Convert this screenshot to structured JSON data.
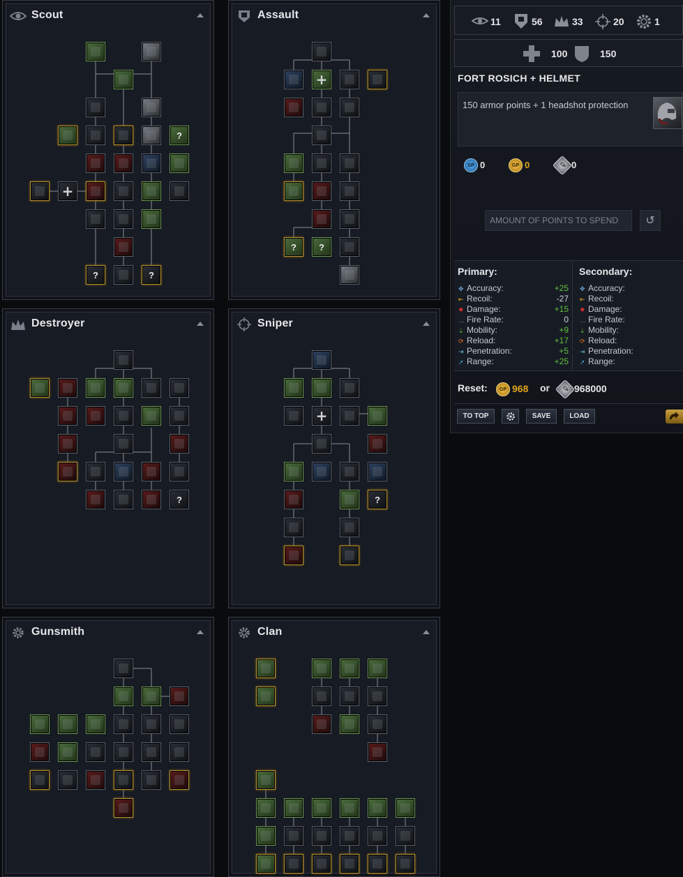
{
  "panels": {
    "scout": {
      "title": "Scout"
    },
    "assault": {
      "title": "Assault"
    },
    "destroyer": {
      "title": "Destroyer"
    },
    "sniper": {
      "title": "Sniper"
    },
    "gunsmith": {
      "title": "Gunsmith"
    },
    "clan": {
      "title": "Clan"
    }
  },
  "skill_labels": {
    "question": "?",
    "plus": "+"
  },
  "stats_bar": {
    "scout": "11",
    "assault": "56",
    "destroyer": "33",
    "sniper": "20",
    "gunsmith": "1"
  },
  "health_bar": {
    "health": "100",
    "armor": "150"
  },
  "item": {
    "title": "FORT ROSICH + HELMET",
    "description": "150 armor points + 1 headshot protection"
  },
  "currencies": [
    {
      "code": "SP",
      "value": "0",
      "color": "#3b8fd6"
    },
    {
      "code": "GP",
      "value": "0",
      "color": "#e0a21d"
    },
    {
      "code": "CP",
      "value": "0",
      "color": "#9aa0a8"
    }
  ],
  "points_input": {
    "placeholder": "AMOUNT OF POINTS TO SPEND"
  },
  "primary": {
    "heading": "Primary:",
    "rows": [
      {
        "label": "Accuracy:",
        "value": "+25",
        "icon": "accuracy-icon"
      },
      {
        "label": "Recoil:",
        "value": "-27",
        "icon": "recoil-icon"
      },
      {
        "label": "Damage:",
        "value": "+15",
        "icon": "damage-icon"
      },
      {
        "label": "Fire Rate:",
        "value": "0",
        "icon": "fire-rate-icon"
      },
      {
        "label": "Mobility:",
        "value": "+9",
        "icon": "mobility-icon"
      },
      {
        "label": "Reload:",
        "value": "+17",
        "icon": "reload-icon"
      },
      {
        "label": "Penetration:",
        "value": "+5",
        "icon": "penetration-icon"
      },
      {
        "label": "Range:",
        "value": "+25",
        "icon": "range-icon"
      }
    ]
  },
  "secondary": {
    "heading": "Secondary:",
    "rows": [
      {
        "label": "Accuracy:"
      },
      {
        "label": "Recoil:"
      },
      {
        "label": "Damage:"
      },
      {
        "label": "Fire Rate:"
      },
      {
        "label": "Mobility:"
      },
      {
        "label": "Reload:"
      },
      {
        "label": "Penetration:"
      },
      {
        "label": "Range:"
      }
    ]
  },
  "reset": {
    "label": "Reset:",
    "gp_value": "968",
    "or": "or",
    "cp_value": "968000",
    "gp_code": "GP",
    "cp_code": "CP"
  },
  "buttons": {
    "to_top": "TO TOP",
    "save": "SAVE",
    "load": "LOAD"
  },
  "colors": {
    "positive": "#5ec23e",
    "negative": "#d0d3d8",
    "gold": "#e0a21d",
    "panel": "#171b23",
    "border": "#383d46"
  }
}
